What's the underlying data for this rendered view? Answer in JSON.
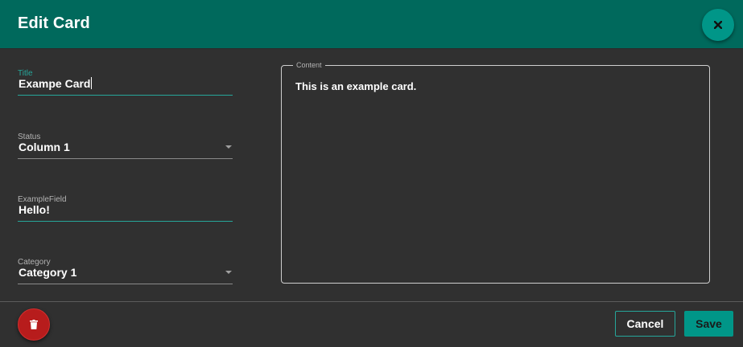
{
  "dialog": {
    "title": "Edit Card",
    "close_icon": "close-icon"
  },
  "fields": {
    "title": {
      "label": "Title",
      "value": "Exampe Card"
    },
    "status": {
      "label": "Status",
      "value": "Column 1",
      "icon": "dropdown-arrow-icon"
    },
    "example_field": {
      "label": "ExampleField",
      "value": "Hello!"
    },
    "category": {
      "label": "Category",
      "value": "Category 1",
      "icon": "dropdown-arrow-icon"
    }
  },
  "content": {
    "label": "Content",
    "value": "This is an example card."
  },
  "footer": {
    "delete_icon": "trash-icon",
    "cancel_label": "Cancel",
    "save_label": "Save"
  },
  "colors": {
    "header": "#00695c",
    "accent": "#009688",
    "accent_line": "#26a69a",
    "background": "#303030",
    "delete": "#b71c1c"
  }
}
